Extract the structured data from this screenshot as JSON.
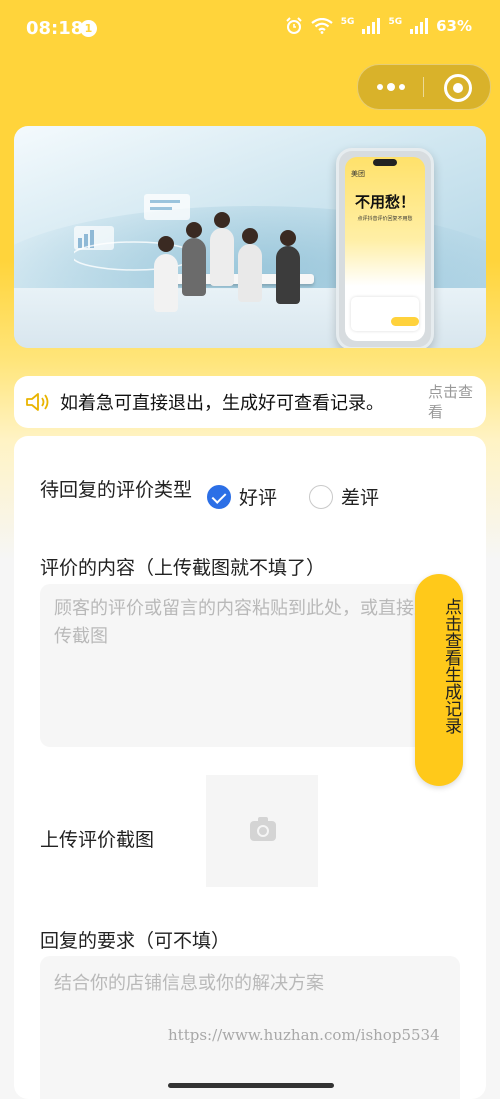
{
  "status_bar": {
    "time": "08:18",
    "notification_badge": "1",
    "network_1": "5G",
    "network_2": "5G",
    "battery": "63%"
  },
  "banner": {
    "app_name": "美团",
    "headline": "不用愁！",
    "subline": "点评抖音评价回复不用愁"
  },
  "notice": {
    "message": "如着急可直接退出，生成好可查看记录。",
    "link_label": "点击查看"
  },
  "form": {
    "review_type_label": "待回复的评价类型",
    "options": [
      {
        "label": "好评",
        "selected": true
      },
      {
        "label": "差评",
        "selected": false
      }
    ],
    "content_label": "评价的内容（上传截图就不填了）",
    "content_placeholder": "顾客的评价或留言的内容粘贴到此处，或直接上传截图",
    "history_button": "点击查看生成记录",
    "upload_label": "上传评价截图",
    "requirement_label": "回复的要求（可不填）",
    "requirement_placeholder": "结合你的店铺信息或你的解决方案"
  },
  "watermark": "https://www.huzhan.com/ishop5534",
  "colors": {
    "brand_yellow": "#FFD43B",
    "history_button": "#FFC91A",
    "radio_selected": "#2C6FE6"
  }
}
